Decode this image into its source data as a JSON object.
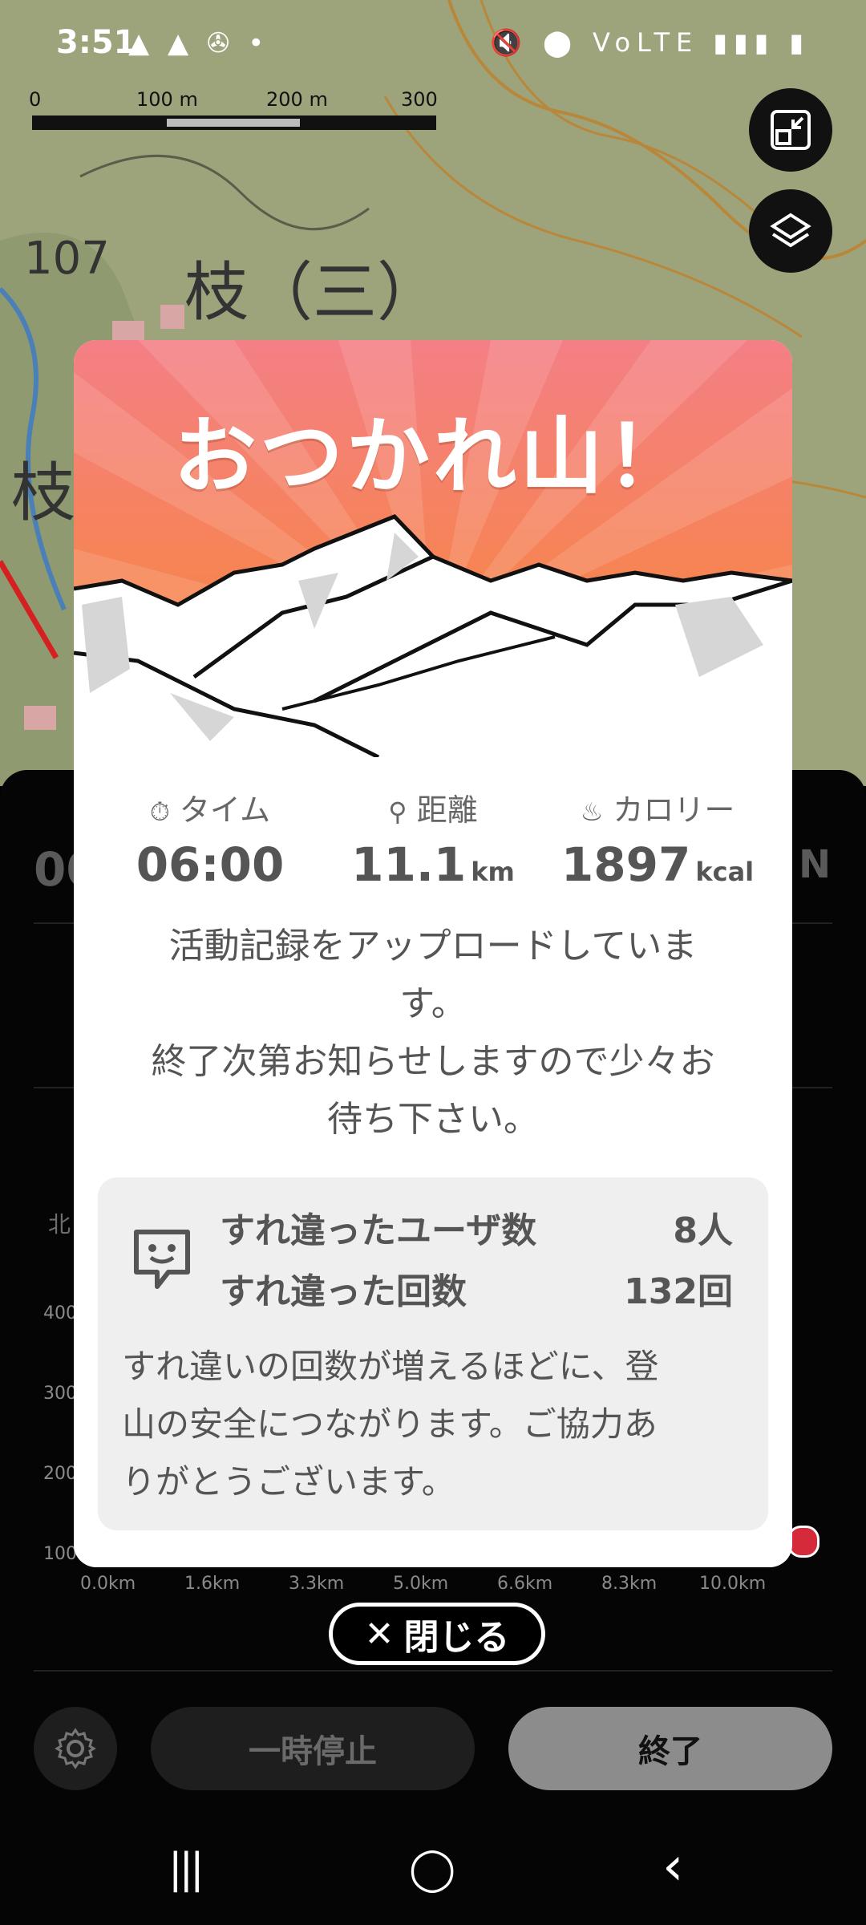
{
  "status_bar": {
    "time": "3:51",
    "left_icons": "▲ ▲ ✇ •",
    "right_icons": "🔇 ⬤ VoLTE ▮▮▮ ▮"
  },
  "scale": {
    "labels": [
      "0",
      "100 m",
      "200 m",
      "300 m"
    ]
  },
  "map_labels": {
    "elevation": "107",
    "kanji1": "枝（三）",
    "kanji2": "枝"
  },
  "modal": {
    "title": "おつかれ山！",
    "stats": {
      "time_label": "タイム",
      "time_value": "06:00",
      "distance_label": "距離",
      "distance_value": "11.1",
      "distance_unit": "km",
      "calorie_label": "カロリー",
      "calorie_value": "1897",
      "calorie_unit": "kcal"
    },
    "upload_message_line1": "活動記録をアップロードしていま",
    "upload_message_line2": "す。",
    "upload_message_line3": "終了次第お知らせしますので少々お",
    "upload_message_line4": "待ち下さい。",
    "passing": {
      "users_label": "すれ違ったユーザ数",
      "users_value": "8人",
      "count_label": "すれ違った回数",
      "count_value": "132回",
      "note_line1": "すれ違いの回数が増えるほどに、登",
      "note_line2": "山の安全につながります。ご協力あ",
      "note_line3": "りがとうございます。"
    }
  },
  "close_button": {
    "label": "閉じる"
  },
  "background_panel": {
    "left_value_fragment": "00",
    "north_fragment": "北",
    "y_axis": [
      "400",
      "300",
      "200",
      "100"
    ],
    "x_axis": [
      "0.0km",
      "1.6km",
      "3.3km",
      "5.0km",
      "6.6km",
      "8.3km",
      "10.0km"
    ]
  },
  "controls": {
    "pause_label": "一時停止",
    "end_label": "終了"
  },
  "nav_bar": {
    "recent": "|||",
    "home": "◯",
    "back": "‹"
  },
  "colors": {
    "hero_top": "#f47f86",
    "hero_bottom": "#f7883a",
    "end_button": "#8c8c8c"
  }
}
